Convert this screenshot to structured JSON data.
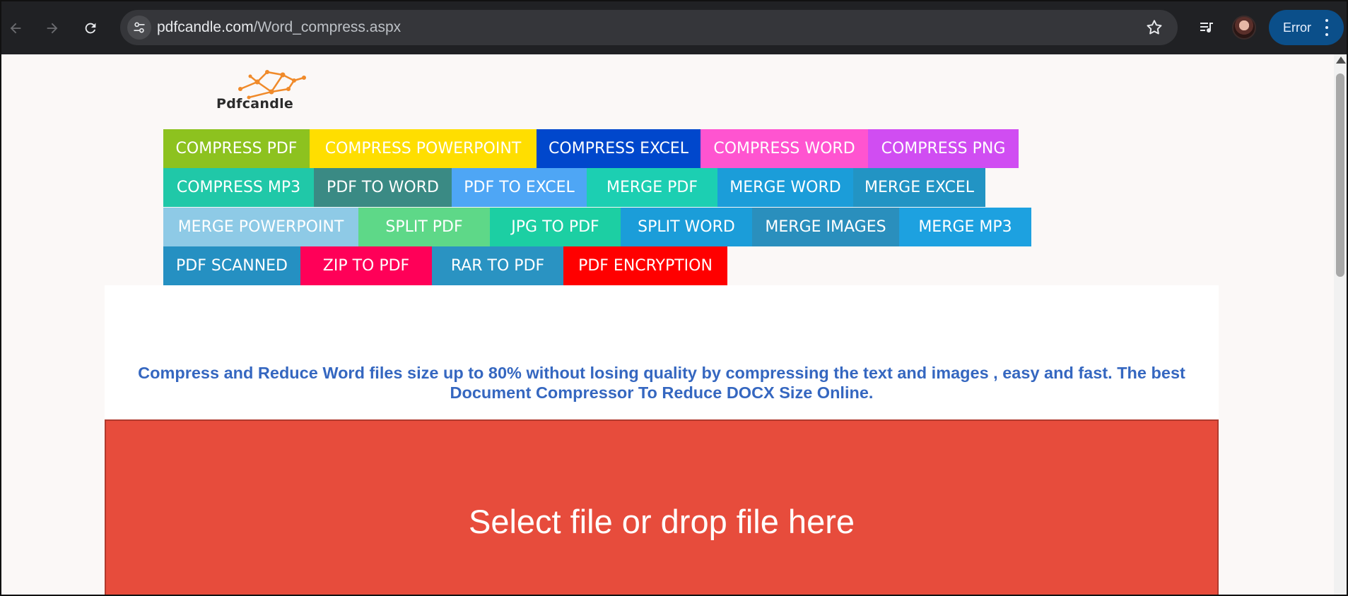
{
  "browser": {
    "url_domain": "pdfcandle.com",
    "url_path": "/Word_compress.aspx",
    "profile_status": "Error",
    "icons": [
      "back-arrow-icon",
      "forward-arrow-icon",
      "reload-icon",
      "site-settings-icon",
      "bookmark-star-icon",
      "media-controls-icon",
      "profile-avatar",
      "more-menu-icon"
    ]
  },
  "site": {
    "logo_text": "Pdfcandle",
    "menu_rows": [
      [
        {
          "label": "COMPRESS PDF",
          "color": "#8dc21f"
        },
        {
          "label": "COMPRESS POWERPOINT",
          "color": "#ffde00"
        },
        {
          "label": "COMPRESS EXCEL",
          "color": "#0047cc"
        },
        {
          "label": "COMPRESS WORD",
          "color": "#ff54d0"
        },
        {
          "label": "COMPRESS PNG",
          "color": "#d04df2"
        }
      ],
      [
        {
          "label": "COMPRESS MP3",
          "color": "#20c8a8"
        },
        {
          "label": "PDF TO WORD",
          "color": "#3a8a84"
        },
        {
          "label": "PDF TO EXCEL",
          "color": "#4ea6f5"
        },
        {
          "label": "MERGE PDF",
          "color": "#1ccfb2"
        },
        {
          "label": "MERGE WORD",
          "color": "#1b9dd9"
        },
        {
          "label": "MERGE EXCEL",
          "color": "#2294c4"
        }
      ],
      [
        {
          "label": "MERGE POWERPOINT",
          "color": "#8ecae6"
        },
        {
          "label": "SPLIT PDF",
          "color": "#5ed888"
        },
        {
          "label": "JPG TO PDF",
          "color": "#1ccfa3"
        },
        {
          "label": "SPLIT WORD",
          "color": "#1b9dd9"
        },
        {
          "label": "MERGE IMAGES",
          "color": "#2a8fbd"
        },
        {
          "label": "MERGE MP3",
          "color": "#1da1e0"
        }
      ],
      [
        {
          "label": "PDF SCANNED",
          "color": "#2590c2"
        },
        {
          "label": "ZIP TO PDF",
          "color": "#ff0058"
        },
        {
          "label": "RAR TO PDF",
          "color": "#2a93c2"
        },
        {
          "label": "PDF ENCRYPTION",
          "color": "#ff0000"
        }
      ]
    ],
    "tagline": "Compress and Reduce Word files size up to 80% without losing quality by compressing the text and images , easy and fast. The best Document Compressor To Reduce DOCX Size Online.",
    "dropzone_label": "Select file or drop file here",
    "accent_color": "#e74c3c",
    "tagline_color": "#3567c0"
  }
}
